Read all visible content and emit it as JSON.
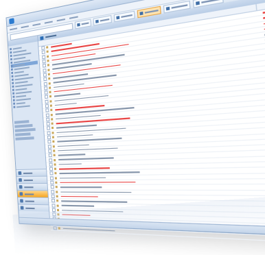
{
  "window": {
    "title": "",
    "search_placeholder": ""
  },
  "menu": {
    "items": [
      "",
      "",
      "",
      "",
      "",
      ""
    ]
  },
  "toolbar": {
    "search_placeholder": "",
    "buttons": [
      {
        "icon": "new-icon",
        "label": ""
      },
      {
        "icon": "reply-icon",
        "label": ""
      },
      {
        "icon": "print-icon",
        "label": ""
      },
      {
        "icon": "delete-icon",
        "label": ""
      },
      {
        "icon": "send-receive-icon",
        "label": ""
      },
      {
        "icon": "addressbook-icon",
        "label": ""
      }
    ]
  },
  "sidebar": {
    "header": "",
    "nav_buttons": [
      {
        "icon": "mail-icon",
        "label": "",
        "active": false
      },
      {
        "icon": "calendar-icon",
        "label": "",
        "active": false
      },
      {
        "icon": "contacts-icon",
        "label": "",
        "active": false
      },
      {
        "icon": "tasks-icon",
        "label": "",
        "active": true
      },
      {
        "icon": "notes-icon",
        "label": "",
        "active": false
      },
      {
        "icon": "folder-icon",
        "label": "",
        "active": false
      }
    ]
  },
  "main": {
    "header": "",
    "columns": {
      "subject": "",
      "due_date": "",
      "flag": ""
    },
    "rows": [
      {
        "overdue": true,
        "flag": "flag"
      },
      {
        "overdue": true,
        "flag": "flag"
      },
      {
        "overdue": true,
        "flag": "flag"
      },
      {
        "overdue": true,
        "flag": "flag"
      },
      {
        "overdue": false,
        "flag": "check"
      },
      {
        "overdue": false,
        "flag": "check"
      },
      {
        "overdue": true,
        "flag": "flag"
      },
      {
        "overdue": false,
        "flag": "check"
      },
      {
        "overdue": false,
        "flag": "check"
      },
      {
        "overdue": false,
        "flag": "check"
      },
      {
        "overdue": true,
        "flag": "flag"
      },
      {
        "overdue": false,
        "flag": "check"
      },
      {
        "overdue": false,
        "flag": "check"
      },
      {
        "overdue": false,
        "flag": "check"
      },
      {
        "overdue": true,
        "flag": "flag"
      },
      {
        "overdue": false,
        "flag": "check"
      },
      {
        "overdue": false,
        "flag": "check"
      },
      {
        "overdue": true,
        "flag": "flag"
      },
      {
        "overdue": false,
        "flag": "check"
      },
      {
        "overdue": false,
        "flag": "check"
      },
      {
        "overdue": false,
        "flag": "check"
      },
      {
        "overdue": false,
        "flag": "check"
      },
      {
        "overdue": false,
        "flag": "check"
      },
      {
        "overdue": false,
        "flag": "check"
      },
      {
        "overdue": false,
        "flag": "check"
      },
      {
        "overdue": false,
        "flag": "check"
      },
      {
        "overdue": false,
        "flag": "check"
      },
      {
        "overdue": true,
        "flag": "flag"
      },
      {
        "overdue": false,
        "flag": "check"
      },
      {
        "overdue": false,
        "flag": "check"
      },
      {
        "overdue": true,
        "flag": "flag"
      },
      {
        "overdue": false,
        "flag": "check"
      },
      {
        "overdue": false,
        "flag": "check"
      },
      {
        "overdue": true,
        "flag": "flag"
      },
      {
        "overdue": false,
        "flag": "check"
      },
      {
        "overdue": false,
        "flag": "check"
      },
      {
        "overdue": false,
        "flag": "check"
      },
      {
        "overdue": true,
        "flag": "flag"
      },
      {
        "overdue": true,
        "flag": "flag"
      },
      {
        "overdue": true,
        "flag": "flag"
      },
      {
        "overdue": false,
        "flag": "check"
      }
    ]
  },
  "right_panel": {
    "label": ""
  },
  "statusbar": {
    "text": ""
  },
  "colors": {
    "accent": "#2b7bd0",
    "overdue": "#e84545",
    "nav_active": "#f5a623",
    "chrome": "#dbe6f4"
  }
}
